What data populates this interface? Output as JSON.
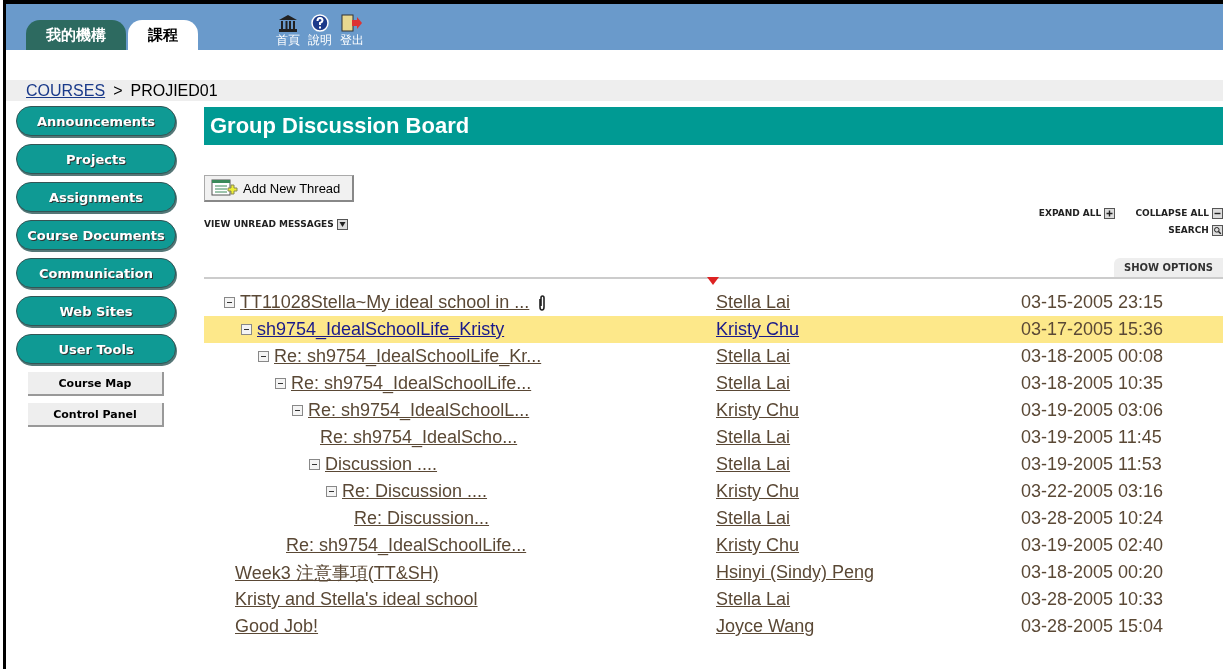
{
  "top_tabs": [
    {
      "label": "我的機構",
      "selected": false
    },
    {
      "label": "課程",
      "selected": true
    }
  ],
  "top_links": [
    {
      "kind": "home",
      "label": "首頁"
    },
    {
      "kind": "help",
      "label": "說明"
    },
    {
      "kind": "logout",
      "label": "登出"
    }
  ],
  "breadcrumb": {
    "link": "COURSES",
    "separator": ">",
    "current": "PROJIED01"
  },
  "sidebar": {
    "menu": [
      "Announcements",
      "Projects",
      "Assignments",
      "Course Documents",
      "Communication",
      "Web Sites",
      "User Tools"
    ],
    "tools": [
      "Course Map",
      "Control Panel"
    ]
  },
  "page_title": "Group Discussion Board",
  "add_button": "Add New Thread",
  "view_unread": "VIEW UNREAD MESSAGES",
  "expand_all": "EXPAND ALL",
  "collapse_all": "COLLAPSE ALL",
  "search": "SEARCH",
  "show_options": "SHOW OPTIONS",
  "threads": [
    {
      "subject": "TT11028Stella~My ideal school in ...",
      "author": "Stella Lai",
      "date": "03-15-2005 23:15",
      "selected": false,
      "attachment": true,
      "expanded": true,
      "children": [
        {
          "subject": "sh9754_IdealSchoolLife_Kristy",
          "author": "Kristy Chu",
          "date": "03-17-2005 15:36",
          "selected": true,
          "attachment": false,
          "expanded": true,
          "children": [
            {
              "subject": "Re: sh9754_IdealSchoolLife_Kr...",
              "author": "Stella Lai",
              "date": "03-18-2005 00:08",
              "selected": false,
              "attachment": false,
              "expanded": true,
              "children": [
                {
                  "subject": "Re: sh9754_IdealSchoolLife...",
                  "author": "Stella Lai",
                  "date": "03-18-2005 10:35",
                  "selected": false,
                  "attachment": false,
                  "expanded": true,
                  "children": [
                    {
                      "subject": "Re: sh9754_IdealSchoolL...",
                      "author": "Kristy Chu",
                      "date": "03-19-2005 03:06",
                      "selected": false,
                      "attachment": false,
                      "expanded": true,
                      "children": [
                        {
                          "subject": "Re: sh9754_IdealScho...",
                          "author": "Stella Lai",
                          "date": "03-19-2005 11:45",
                          "selected": false,
                          "attachment": false
                        },
                        {
                          "subject": "Discussion ....",
                          "author": "Stella Lai",
                          "date": "03-19-2005 11:53",
                          "selected": false,
                          "attachment": false,
                          "expanded": true,
                          "children": [
                            {
                              "subject": "Re: Discussion ....",
                              "author": "Kristy Chu",
                              "date": "03-22-2005 03:16",
                              "selected": false,
                              "attachment": false,
                              "expanded": true,
                              "children": [
                                {
                                  "subject": "Re: Discussion...",
                                  "author": "Stella Lai",
                                  "date": "03-28-2005 10:24",
                                  "selected": false,
                                  "attachment": false
                                }
                              ]
                            }
                          ]
                        }
                      ]
                    }
                  ]
                },
                {
                  "subject": "Re: sh9754_IdealSchoolLife...",
                  "author": "Kristy Chu",
                  "date": "03-19-2005 02:40",
                  "selected": false,
                  "attachment": false
                }
              ]
            }
          ]
        }
      ]
    },
    {
      "subject": "Week3 注意事項(TT&SH)",
      "author": "Hsinyi (Sindy) Peng",
      "date": "03-18-2005 00:20",
      "selected": false,
      "attachment": false
    },
    {
      "subject": "Kristy and Stella's ideal school",
      "author": "Stella Lai",
      "date": "03-28-2005 10:33",
      "selected": false,
      "attachment": false
    },
    {
      "subject": "Good Job!",
      "author": "Joyce Wang",
      "date": "03-28-2005 15:04",
      "selected": false,
      "attachment": false
    }
  ]
}
